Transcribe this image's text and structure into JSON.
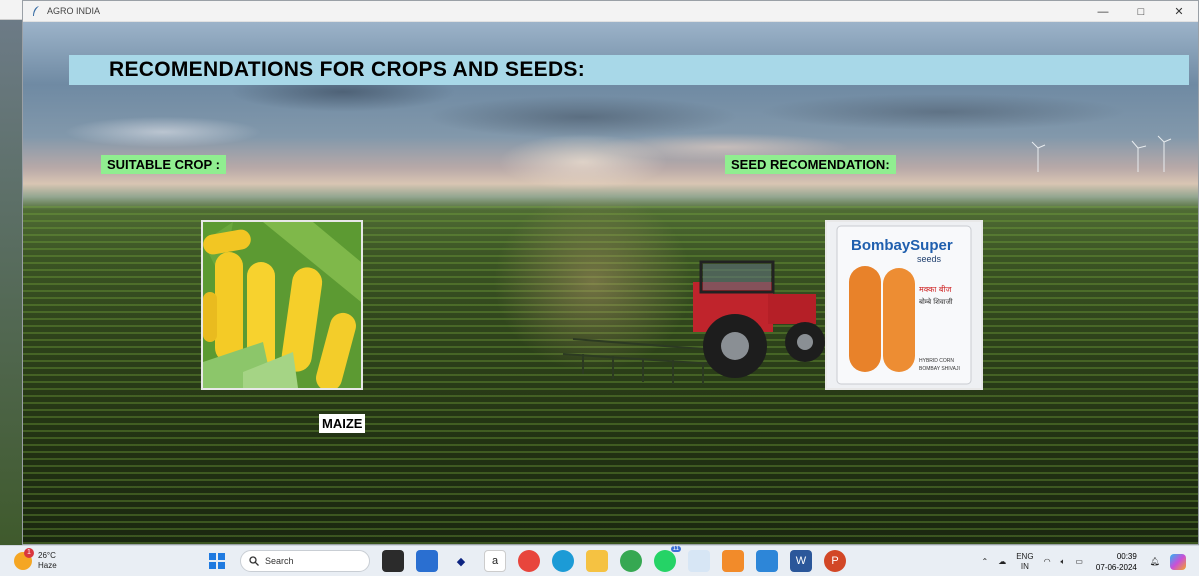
{
  "window": {
    "title": "AGRO INDIA",
    "controls": {
      "minimize": "—",
      "maximize": "□",
      "close": "✕"
    }
  },
  "content": {
    "heading": "RECOMENDATIONS FOR CROPS AND SEEDS:",
    "suitable_crop_label": "SUITABLE CROP :",
    "seed_recommendation_label": "SEED RECOMENDATION:",
    "crop_name": "MAIZE",
    "seed_brand_text": "BombaySuper",
    "seed_sub_text": "seeds",
    "seed_hindi_text": "मक्का बीज",
    "seed_hindi_sub": "बोम्बे शिवाजी",
    "seed_type_text": "HYBRID CORN",
    "seed_variety_text": "BOMBAY SHIVAJI"
  },
  "taskbar": {
    "weather": {
      "temperature": "26°C",
      "condition": "Haze",
      "badge": "1"
    },
    "search_placeholder": "Search",
    "tray": {
      "language": "ENG",
      "region": "IN",
      "time": "00:39",
      "date": "07-06-2024"
    },
    "whatsapp_badge": "11"
  }
}
